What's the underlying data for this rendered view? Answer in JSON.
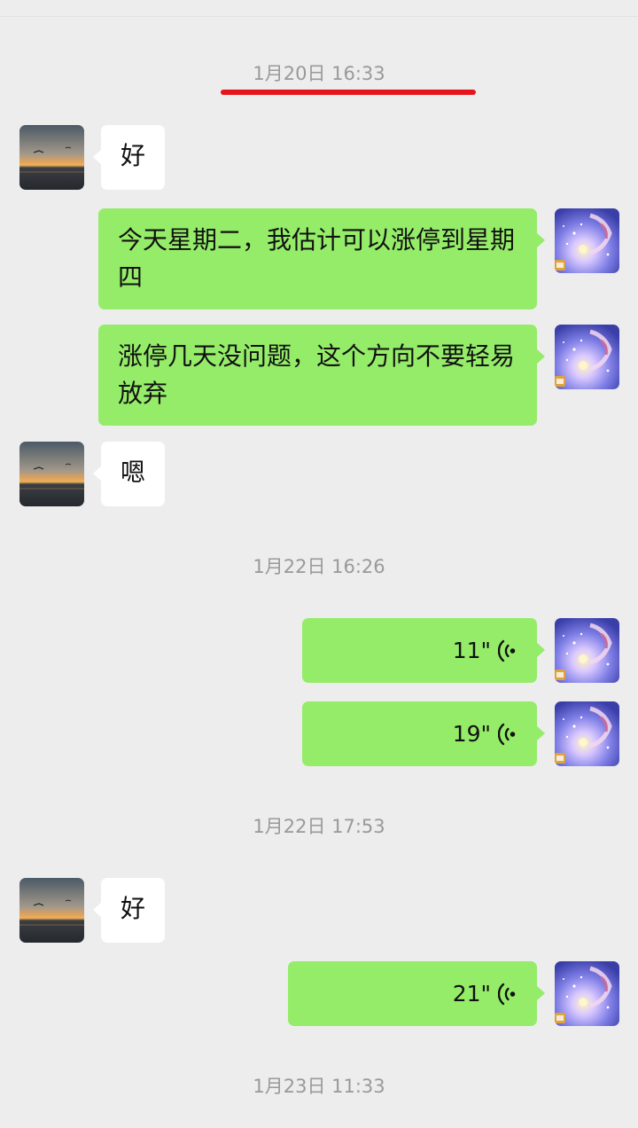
{
  "timestamps": {
    "t1": "1月20日 16:33",
    "t2": "1月22日 16:26",
    "t3": "1月22日 17:53",
    "t4": "1月23日 11:33"
  },
  "messages": {
    "m1": "好",
    "m2": "今天星期二，我估计可以涨停到星期四",
    "m3": "涨停几天没问题，这个方向不要轻易放弃",
    "m4": "嗯",
    "m5": "11\"",
    "m6": "19\"",
    "m7": "好",
    "m8": "21\""
  },
  "colors": {
    "background": "#ededed",
    "outgoing_bubble": "#95ec69",
    "incoming_bubble": "#ffffff",
    "timestamp_text": "#999999",
    "annotation_underline": "#e8141b"
  },
  "icons": {
    "contact_avatar": "sunset-avatar",
    "self_avatar": "anime-girl-avatar",
    "voice": "voice-wave-icon"
  }
}
